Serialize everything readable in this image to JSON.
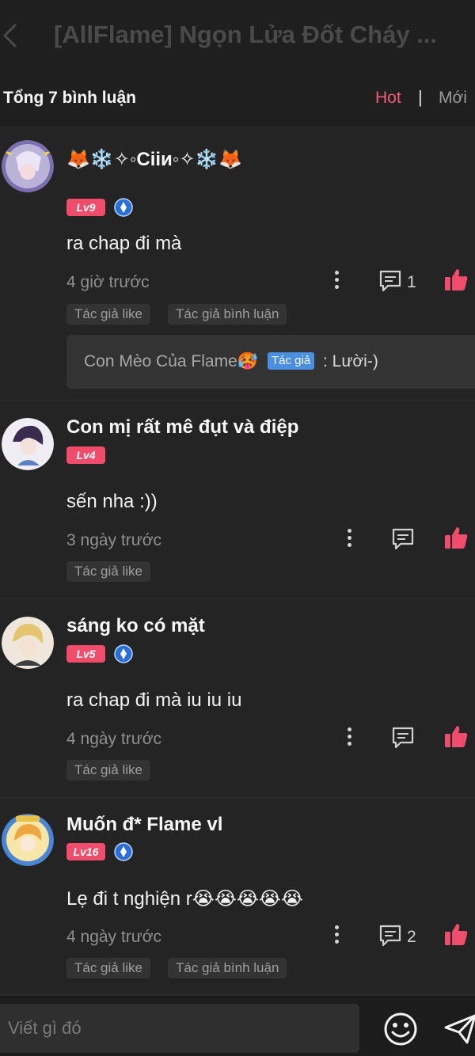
{
  "header": {
    "title": "[AllFlame] Ngọn Lửa Đốt Cháy ..."
  },
  "comment_bar": {
    "total_label": "Tổng 7 bình luận",
    "sort_hot": "Hot",
    "separator": "|",
    "sort_new": "Mới"
  },
  "comments": [
    {
      "username": "🦊❄️✧◦Ciiи◦✧❄️🦊",
      "level": "Lv9",
      "text": "ra chap đi mà",
      "time": "4 giờ trước",
      "reply_count": "1",
      "tags": [
        "Tác giả like",
        "Tác giả bình luận"
      ],
      "reply": {
        "name": "Con Mèo Của Flame🥵",
        "author_tag": "Tác giả",
        "text": ": Lười-)"
      }
    },
    {
      "username": "Con mị rất mê đụt và điệp",
      "level": "Lv4",
      "text": "sến nha :))",
      "time": "3 ngày trước",
      "tags": [
        "Tác giả like"
      ]
    },
    {
      "username": "sáng ko có mặt",
      "level": "Lv5",
      "text": "ra chap đi mà iu iu iu",
      "time": "4 ngày trước",
      "tags": [
        "Tác giả like"
      ]
    },
    {
      "username": "Muốn đ* Flame vl",
      "level": "Lv16",
      "text": "Lẹ đi t nghiện r😭😭😭😭😭",
      "time": "4 ngày trước",
      "reply_count": "2",
      "tags": [
        "Tác giả like",
        "Tác giả bình luận"
      ]
    }
  ],
  "composer": {
    "placeholder": "Viết gì đó"
  },
  "colors": {
    "accent": "#f25c7a",
    "level_badge": "#ef4d6b",
    "author_tag": "#4a8fe0",
    "background": "#242424"
  },
  "icons": [
    "back-icon",
    "verified-badge-icon",
    "more-vertical-icon",
    "comment-icon",
    "thumbs-up-icon",
    "smiley-icon",
    "send-icon"
  ]
}
